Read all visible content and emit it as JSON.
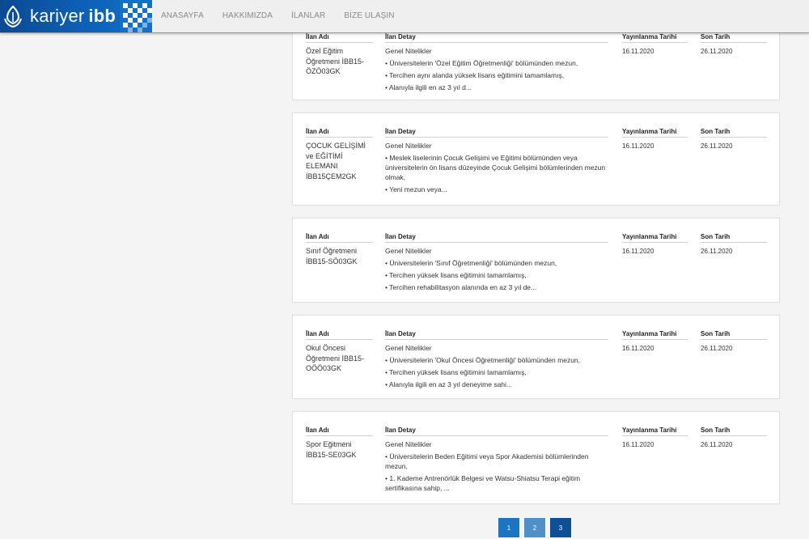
{
  "header": {
    "brand_prefix": "kariyer",
    "brand_name": "ibb",
    "nav": [
      "ANASAYFA",
      "HAKKIMIZDA",
      "İLANLAR",
      "BİZE ULAŞIN"
    ]
  },
  "colors": {
    "brand_blue": "#0d62b8",
    "page_bg": "#f4f4f4",
    "pager_active": "#1d74c0",
    "pager_dark": "#0e5096"
  },
  "labels": {
    "ilan_adi": "İlan Adı",
    "ilan_detay": "İlan Detay",
    "yayinlanma_tarihi": "Yayınlanma Tarihi",
    "son_tarih": "Son Tarih",
    "genel_nitelikler": "Genel Nitelikler"
  },
  "jobs": [
    {
      "title": "Özel Eğitim Öğretmeni İBB15-ÖZÖ03GK",
      "bullets": [
        "• Üniversitelerin 'Özel Eğitim Öğretmenliği' bölümünden mezun,",
        "• Tercihen aynı alanda yüksek lisans eğitimini tamamlamış,",
        "• Alanıyla ilgili en az 3 yıl d..."
      ],
      "published": "16.11.2020",
      "deadline": "26.11.2020"
    },
    {
      "title": "ÇOCUK GELİŞİMİ ve EĞİTİMİ ELEMANI İBB15ÇEM2GK",
      "bullets": [
        "• Meslek liselerinin Çocuk Gelişimi ve Eğitimi bölümünden veya üniversitelerin ön lisans düzeyinde Çocuk Gelişimi bölümlerinden mezun olmak,",
        "• Yeni mezun veya..."
      ],
      "published": "16.11.2020",
      "deadline": "26.11.2020"
    },
    {
      "title": "Sınıf Öğretmeni İBB15-SÖ03GK",
      "bullets": [
        "• Üniversitelerin 'Sınıf Öğretmenliği' bölümünden mezun,",
        "• Tercihen yüksek lisans eğitimini tamamlamış,",
        "• Tercihen rehabilitasyon alanında en az 3 yıl de..."
      ],
      "published": "16.11.2020",
      "deadline": "26.11.2020"
    },
    {
      "title": "Okul Öncesi Öğretmeni İBB15-OÖÖ03GK",
      "bullets": [
        "• Üniversitelerin 'Okul Öncesi Öğretmenliği' bölümünden mezun,",
        "• Tercihen yüksek lisans eğitimini tamamlamış,",
        "• Alanıyla ilgili en az 3 yıl deneyime sahi..."
      ],
      "published": "16.11.2020",
      "deadline": "26.11.2020"
    },
    {
      "title": "Spor Eğitmeni İBB15-SE03GK",
      "bullets": [
        "• Üniversitelerin Beden Eğitimi veya Spor Akademisi bölümlerinden mezun,",
        "• 1. Kademe Antrenörlük Belgesi ve Watsu-Shiatsu Terapi eğitim sertifikasına sahip, ..."
      ],
      "published": "16.11.2020",
      "deadline": "26.11.2020"
    }
  ],
  "pagination": [
    "1",
    "2",
    "3"
  ]
}
